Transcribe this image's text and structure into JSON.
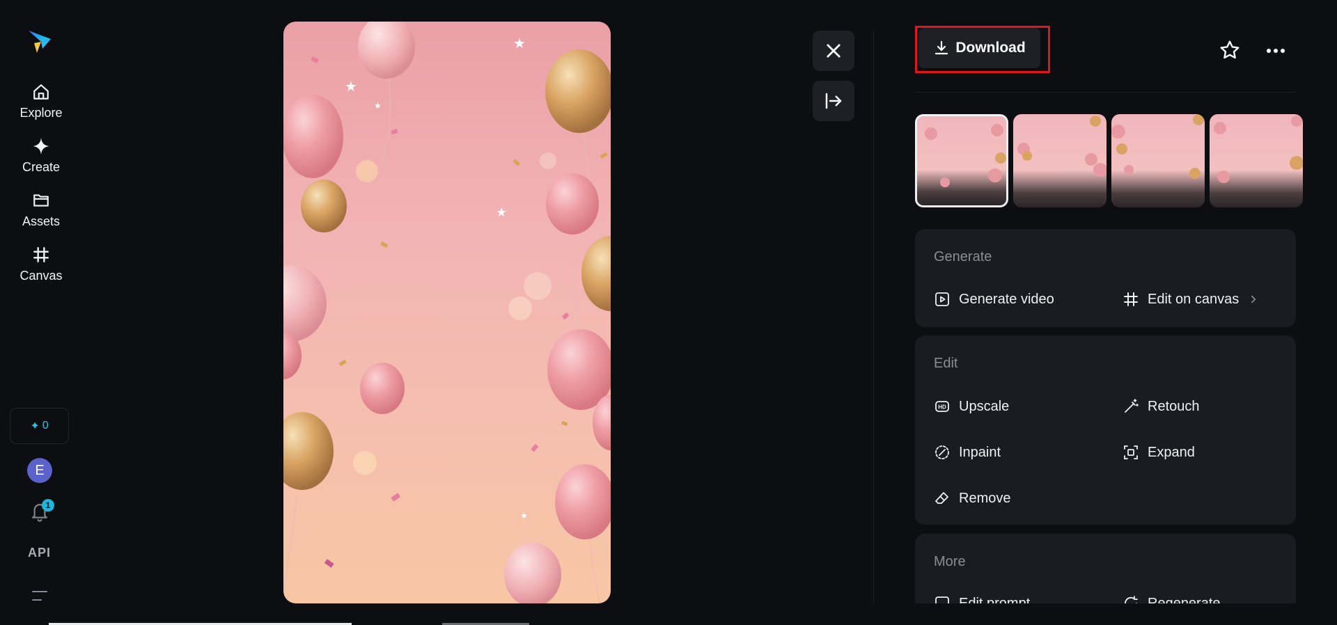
{
  "nav": {
    "items": [
      {
        "label": "Explore",
        "icon": "home-icon"
      },
      {
        "label": "Create",
        "icon": "sparkle-icon"
      },
      {
        "label": "Assets",
        "icon": "folder-icon"
      },
      {
        "label": "Canvas",
        "icon": "canvas-grid-icon"
      }
    ],
    "credits": "0",
    "avatar_initial": "E",
    "notification_count": "1",
    "api_label": "API"
  },
  "toolbar": {
    "download_label": "Download"
  },
  "thumbnails_count_note": "",
  "generate": {
    "title": "Generate",
    "actions": [
      {
        "label": "Generate video",
        "icon": "play-square-icon"
      },
      {
        "label": "Edit on canvas",
        "icon": "canvas-grid-icon"
      }
    ]
  },
  "edit": {
    "title": "Edit",
    "actions": [
      {
        "label": "Upscale",
        "icon": "hd-icon"
      },
      {
        "label": "Retouch",
        "icon": "magic-wand-icon"
      },
      {
        "label": "Inpaint",
        "icon": "inpaint-brush-icon"
      },
      {
        "label": "Expand",
        "icon": "expand-icon"
      },
      {
        "label": "Remove",
        "icon": "eraser-icon"
      }
    ]
  },
  "more": {
    "title": "More",
    "actions": [
      {
        "label": "Edit prompt",
        "icon": "edit-prompt-icon"
      },
      {
        "label": "Regenerate",
        "icon": "regenerate-icon"
      }
    ]
  },
  "colors": {
    "background": "#0d0e11",
    "card": "#1b1c21",
    "accent": "#2bc4e8",
    "highlight": "#e0161d"
  }
}
